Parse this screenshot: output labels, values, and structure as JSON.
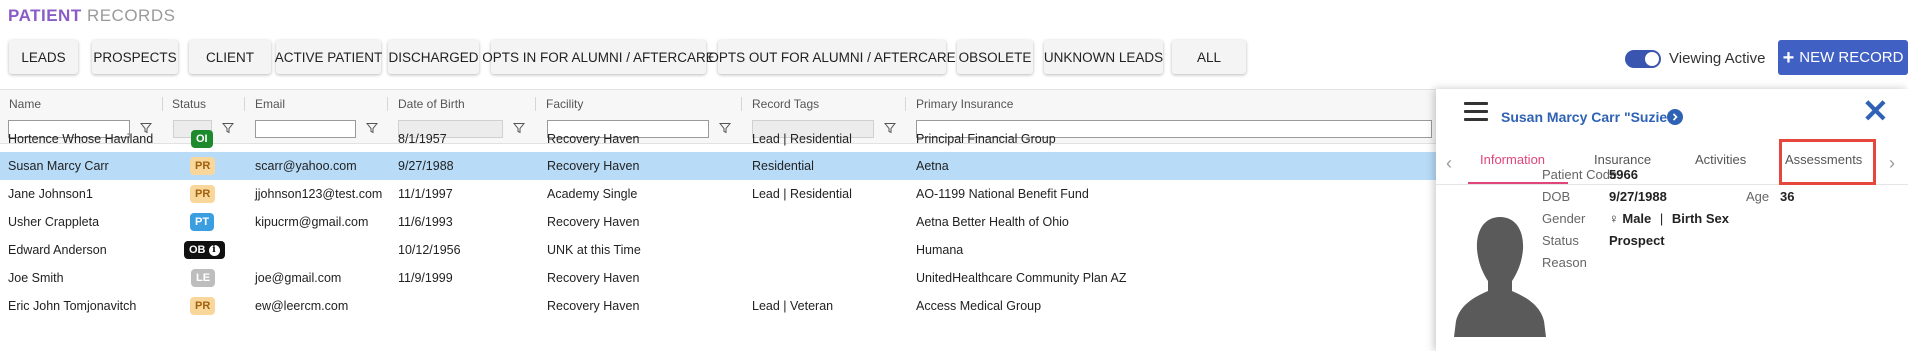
{
  "header": {
    "title_part1": "PATIENT",
    "title_part2": "RECORDS"
  },
  "filters": [
    "LEADS",
    "PROSPECTS",
    "CLIENT",
    "ACTIVE PATIENT",
    "DISCHARGED",
    "OPTS IN FOR ALUMNI / AFTERCARE",
    "OPTS OUT FOR ALUMNI / AFTERCARE",
    "OBSOLETE",
    "UNKNOWN LEADS",
    "ALL"
  ],
  "toolbar": {
    "viewing_active_label": "Viewing Active",
    "viewing_active_on": true,
    "new_record_label": "NEW RECORD"
  },
  "table": {
    "columns": [
      "Name",
      "Status",
      "Email",
      "Date of Birth",
      "Facility",
      "Record Tags",
      "Primary Insurance"
    ],
    "rows": [
      {
        "name": "Hortence Whose Haviland",
        "status": "OI",
        "status_color": "#1d8a2e",
        "status_text_color": "#ffffff",
        "email": "",
        "dob": "8/1/1957",
        "facility": "Recovery Haven",
        "tags": "Lead | Residential",
        "insurance": "Principal Financial Group"
      },
      {
        "name": "Susan Marcy Carr",
        "status": "PR",
        "status_color": "#f9d69a",
        "status_text_color": "#a0600d",
        "email": "scarr@yahoo.com",
        "dob": "9/27/1988",
        "facility": "Recovery Haven",
        "tags": "Residential",
        "insurance": "Aetna",
        "selected": true
      },
      {
        "name": "Jane Johnson1",
        "status": "PR",
        "status_color": "#f9d69a",
        "status_text_color": "#a0600d",
        "email": "jjohnson123@test.com",
        "dob": "11/1/1997",
        "facility": "Academy Single",
        "tags": "Lead | Residential",
        "insurance": "AO-1199 National Benefit Fund"
      },
      {
        "name": "Usher Crappleta",
        "status": "PT",
        "status_color": "#3a9ee0",
        "status_text_color": "#ffffff",
        "email": "kipucrm@gmail.com",
        "dob": "11/6/1993",
        "facility": "Recovery Haven",
        "tags": "",
        "insurance": "Aetna Better Health of Ohio"
      },
      {
        "name": "Edward Anderson",
        "status": "OB",
        "status_color": "#111111",
        "status_text_color": "#ffffff",
        "status_info_icon": "i",
        "email": "",
        "dob": "10/12/1956",
        "facility": "UNK at this Time",
        "tags": "",
        "insurance": "Humana"
      },
      {
        "name": "Joe Smith",
        "status": "LE",
        "status_color": "#bdbdbd",
        "status_text_color": "#ffffff",
        "email": "joe@gmail.com",
        "dob": "11/9/1999",
        "facility": "Recovery Haven",
        "tags": "",
        "insurance": "UnitedHealthcare Community Plan AZ"
      },
      {
        "name": "Eric John Tomjonavitch",
        "status": "PR",
        "status_color": "#f9d69a",
        "status_text_color": "#a0600d",
        "email": "ew@leercm.com",
        "dob": "",
        "facility": "Recovery Haven",
        "tags": "Lead | Veteran",
        "insurance": "Access Medical Group"
      }
    ]
  },
  "panel": {
    "patient_name": "Susan Marcy Carr \"Suzie\"",
    "tabs": [
      "Information",
      "Insurance",
      "Activities",
      "Assessments"
    ],
    "active_tab": "Information",
    "highlighted_tab": "Assessments",
    "info": {
      "patient_code_label": "Patient Code",
      "patient_code": "5966",
      "dob_label": "DOB",
      "dob": "9/27/1988",
      "age_label": "Age",
      "age": "36",
      "gender_label": "Gender",
      "gender_icon": "♀",
      "gender": "Male",
      "gender_sep": "|",
      "birth_sex": "Birth Sex",
      "status_label": "Status",
      "status": "Prospect",
      "reason_label": "Reason",
      "reason": ""
    }
  }
}
